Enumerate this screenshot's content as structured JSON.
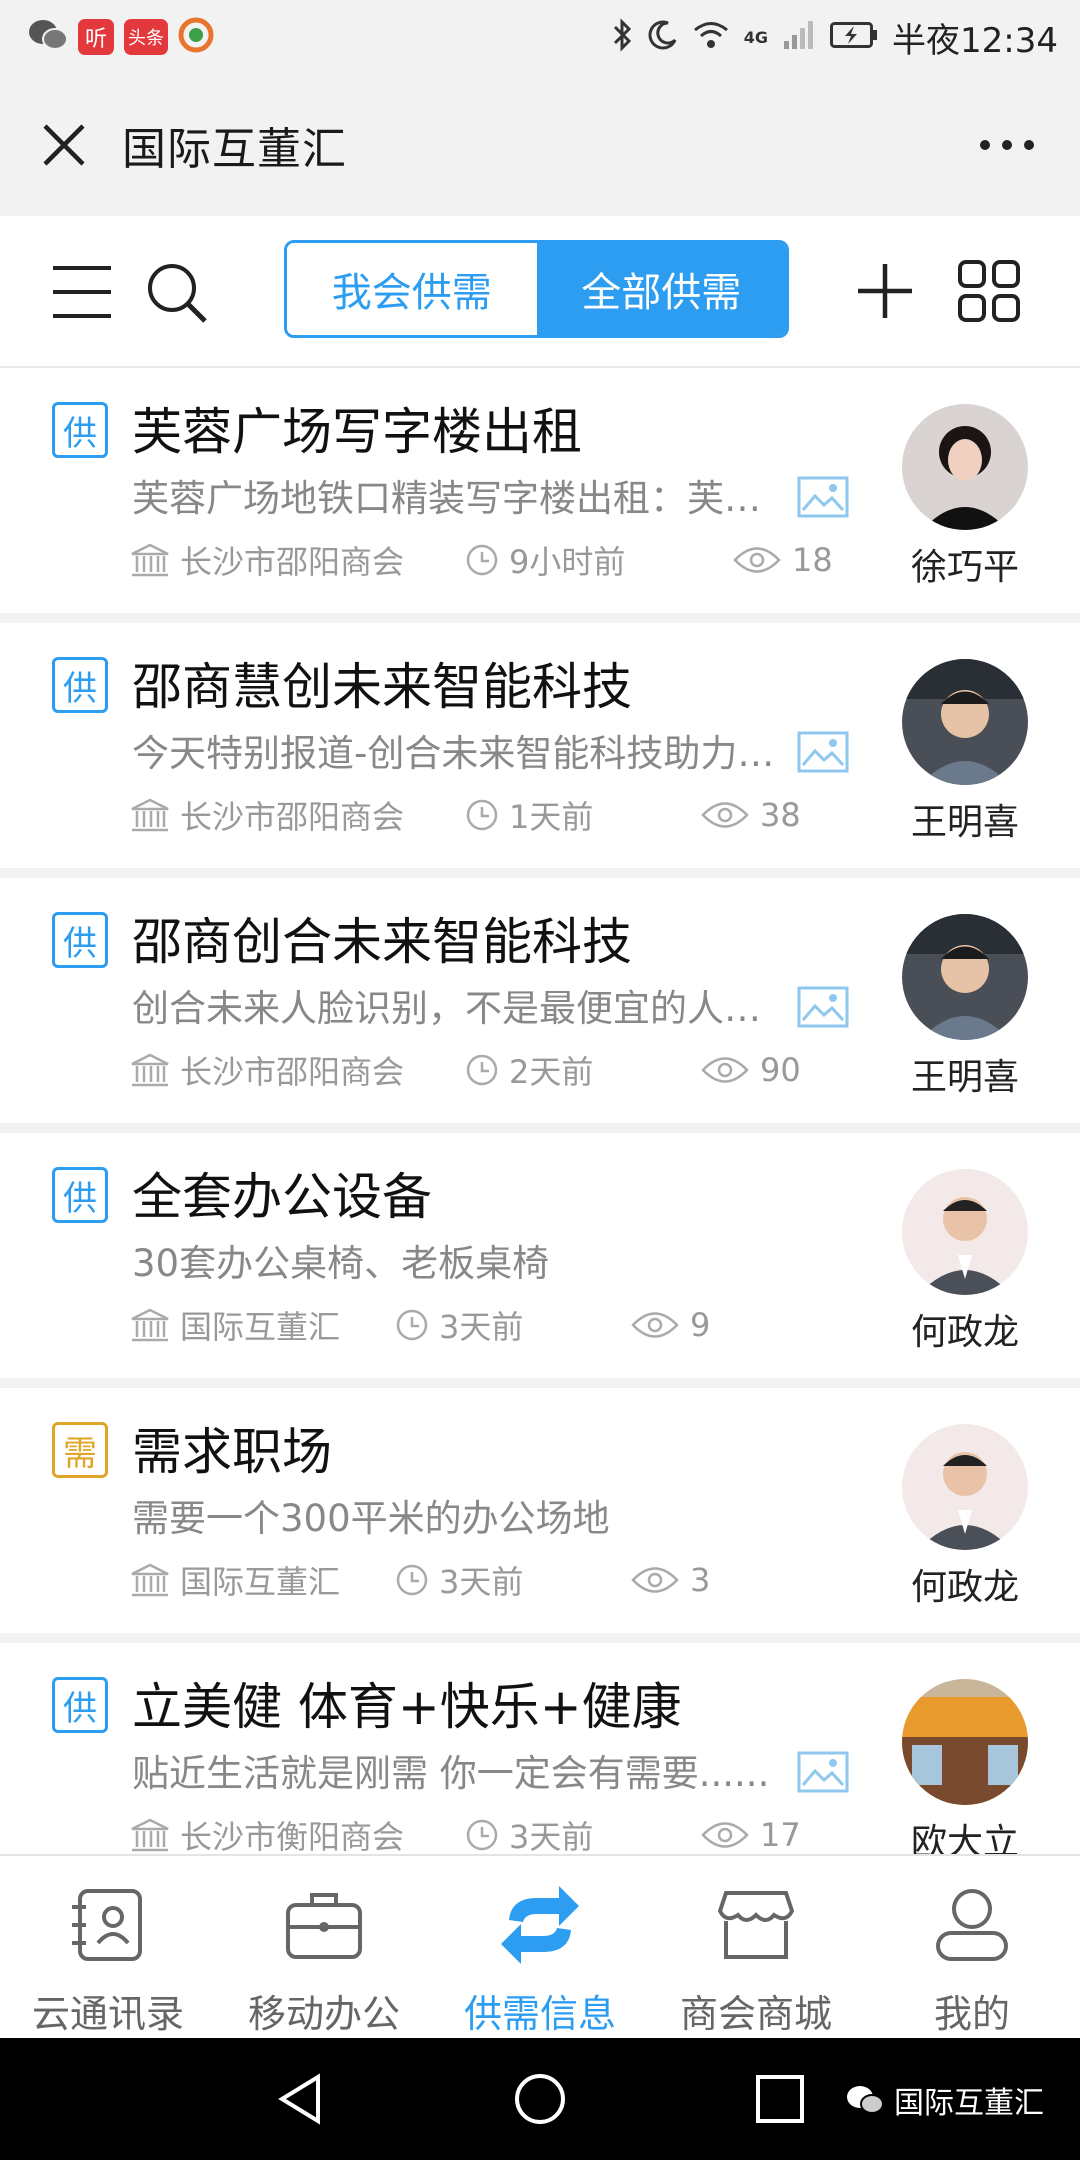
{
  "status_bar": {
    "app_badges": [
      "听",
      "头条"
    ],
    "network": "4G",
    "time": "半夜12:34"
  },
  "title_bar": {
    "title": "国际互董汇",
    "close_icon": "close-icon",
    "more_icon": "more-icon"
  },
  "toolbar": {
    "menu_icon": "menu-icon",
    "search_icon": "search-icon",
    "tabs": [
      {
        "label": "我会供需",
        "active": false
      },
      {
        "label": "全部供需",
        "active": true
      }
    ],
    "add_icon": "plus-icon",
    "grid_icon": "grid-icon",
    "accent_color": "#2c9df0"
  },
  "items": [
    {
      "tag": "供",
      "tag_color": "#2c9df0",
      "title": "芙蓉广场写字楼出租",
      "desc": "芙蓉广场地铁口精装写字楼出租：芙蓉广场地铁口精装写字楼出租",
      "has_image": true,
      "org": "长沙市邵阳商会",
      "time": "9小时前",
      "views": "18",
      "author": "徐巧平"
    },
    {
      "tag": "供",
      "tag_color": "#2c9df0",
      "title": "邵商慧创未来智能科技",
      "desc": "今天特别报道-创合未来智能科技助力企业发展",
      "has_image": true,
      "org": "长沙市邵阳商会",
      "time": "1天前",
      "views": "38",
      "author": "王明喜"
    },
    {
      "tag": "供",
      "tag_color": "#2c9df0",
      "title": "邵商创合未来智能科技",
      "desc": "创合未来人脸识别，不是最便宜的人脸识别",
      "has_image": true,
      "org": "长沙市邵阳商会",
      "time": "2天前",
      "views": "90",
      "author": "王明喜"
    },
    {
      "tag": "供",
      "tag_color": "#2c9df0",
      "title": "全套办公设备",
      "desc": "30套办公桌椅、老板桌椅",
      "has_image": false,
      "org": "国际互董汇",
      "time": "3天前",
      "views": "9",
      "author": "何政龙"
    },
    {
      "tag": "需",
      "tag_color": "#e0a526",
      "title": "需求职场",
      "desc": "需要一个300平米的办公场地",
      "has_image": false,
      "org": "国际互董汇",
      "time": "3天前",
      "views": "3",
      "author": "何政龙"
    },
    {
      "tag": "供",
      "tag_color": "#2c9df0",
      "title": "立美健 体育+快乐+健康",
      "desc": "贴近生活就是刚需 你一定会有需要......",
      "has_image": true,
      "org": "长沙市衡阳商会",
      "time": "3天前",
      "views": "17",
      "author": "欧大立"
    }
  ],
  "bottom_nav": [
    {
      "label": "云通讯录",
      "icon": "contacts-icon",
      "active": false
    },
    {
      "label": "移动办公",
      "icon": "briefcase-icon",
      "active": false
    },
    {
      "label": "供需信息",
      "icon": "exchange-icon",
      "active": true
    },
    {
      "label": "商会商城",
      "icon": "store-icon",
      "active": false
    },
    {
      "label": "我的",
      "icon": "profile-icon",
      "active": false
    }
  ],
  "watermark": "国际互董汇"
}
